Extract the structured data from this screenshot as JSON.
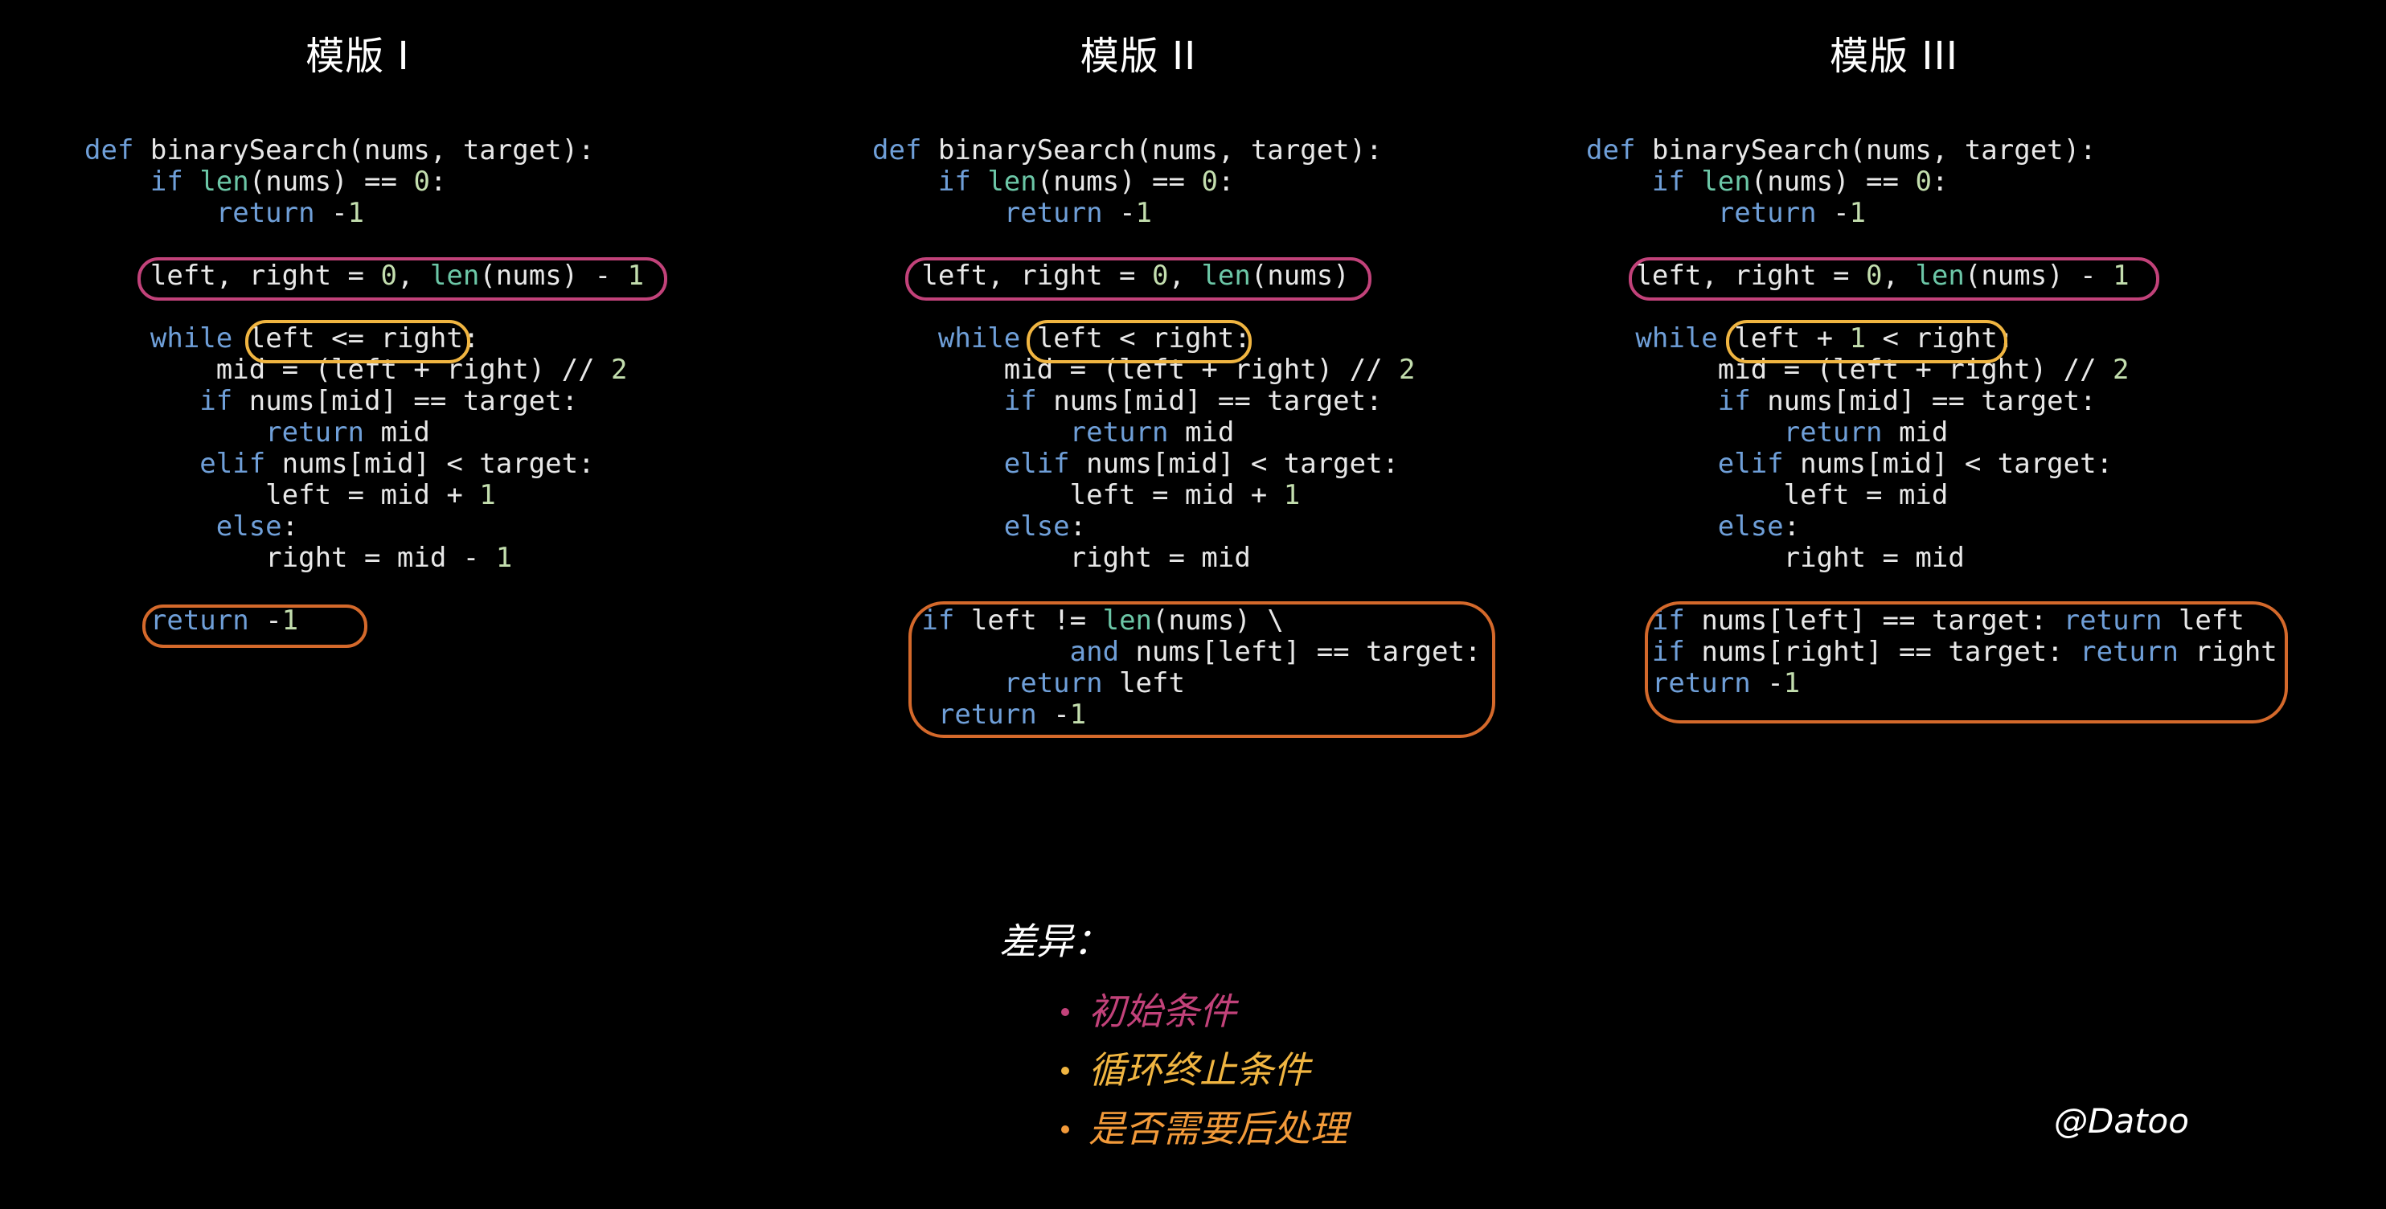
{
  "titles": [
    "模版 I",
    "模版 II",
    "模版 III"
  ],
  "colors": {
    "keyword": "#6f9fd8",
    "builtin": "#6cc7a7",
    "number": "#c3deae",
    "text": "#e8e8e8",
    "init_highlight": "#c2427a",
    "loop_highlight": "#f0b541",
    "post_highlight": "#d4692b"
  },
  "templates": [
    {
      "name": "模版 I",
      "lines": [
        [
          [
            "kw",
            "def"
          ],
          [
            "t",
            " binarySearch(nums, target):"
          ]
        ],
        [
          [
            "t",
            "    "
          ],
          [
            "kw",
            "if"
          ],
          [
            "t",
            " "
          ],
          [
            "fn",
            "len"
          ],
          [
            "t",
            "(nums) == "
          ],
          [
            "num",
            "0"
          ],
          [
            "t",
            ":"
          ]
        ],
        [
          [
            "t",
            "        "
          ],
          [
            "kw",
            "return"
          ],
          [
            "t",
            " -"
          ],
          [
            "num",
            "1"
          ]
        ],
        [],
        [
          [
            "t",
            "    left, right = "
          ],
          [
            "num",
            "0"
          ],
          [
            "t",
            ", "
          ],
          [
            "fn",
            "len"
          ],
          [
            "t",
            "(nums) - "
          ],
          [
            "num",
            "1"
          ]
        ],
        [],
        [
          [
            "t",
            "    "
          ],
          [
            "kw",
            "while"
          ],
          [
            "t",
            " left <= right:"
          ]
        ],
        [
          [
            "t",
            "        mid = (left + right) // "
          ],
          [
            "num",
            "2"
          ]
        ],
        [
          [
            "t",
            "       "
          ],
          [
            "kw",
            "if"
          ],
          [
            "t",
            " nums[mid] == target:"
          ]
        ],
        [
          [
            "t",
            "           "
          ],
          [
            "kw",
            "return"
          ],
          [
            "t",
            " mid"
          ]
        ],
        [
          [
            "t",
            "       "
          ],
          [
            "kw",
            "elif"
          ],
          [
            "t",
            " nums[mid] < target:"
          ]
        ],
        [
          [
            "t",
            "           left = mid + "
          ],
          [
            "num",
            "1"
          ]
        ],
        [
          [
            "t",
            "        "
          ],
          [
            "kw",
            "else"
          ],
          [
            "t",
            ":"
          ]
        ],
        [
          [
            "t",
            "           right = mid - "
          ],
          [
            "num",
            "1"
          ]
        ],
        [],
        [
          [
            "t",
            "    "
          ],
          [
            "kw",
            "return"
          ],
          [
            "t",
            " -"
          ],
          [
            "num",
            "1"
          ]
        ]
      ]
    },
    {
      "name": "模版 II",
      "lines": [
        [
          [
            "kw",
            "def"
          ],
          [
            "t",
            " binarySearch(nums, target):"
          ]
        ],
        [
          [
            "t",
            "    "
          ],
          [
            "kw",
            "if"
          ],
          [
            "t",
            " "
          ],
          [
            "fn",
            "len"
          ],
          [
            "t",
            "(nums) == "
          ],
          [
            "num",
            "0"
          ],
          [
            "t",
            ":"
          ]
        ],
        [
          [
            "t",
            "        "
          ],
          [
            "kw",
            "return"
          ],
          [
            "t",
            " -"
          ],
          [
            "num",
            "1"
          ]
        ],
        [],
        [
          [
            "t",
            "   left, right = "
          ],
          [
            "num",
            "0"
          ],
          [
            "t",
            ", "
          ],
          [
            "fn",
            "len"
          ],
          [
            "t",
            "(nums)"
          ]
        ],
        [],
        [
          [
            "t",
            "    "
          ],
          [
            "kw",
            "while"
          ],
          [
            "t",
            " left < right:"
          ]
        ],
        [
          [
            "t",
            "        mid = (left + right) // "
          ],
          [
            "num",
            "2"
          ]
        ],
        [
          [
            "t",
            "        "
          ],
          [
            "kw",
            "if"
          ],
          [
            "t",
            " nums[mid] == target:"
          ]
        ],
        [
          [
            "t",
            "            "
          ],
          [
            "kw",
            "return"
          ],
          [
            "t",
            " mid"
          ]
        ],
        [
          [
            "t",
            "        "
          ],
          [
            "kw",
            "elif"
          ],
          [
            "t",
            " nums[mid] < target:"
          ]
        ],
        [
          [
            "t",
            "            left = mid + "
          ],
          [
            "num",
            "1"
          ]
        ],
        [
          [
            "t",
            "        "
          ],
          [
            "kw",
            "else"
          ],
          [
            "t",
            ":"
          ]
        ],
        [
          [
            "t",
            "            right = mid"
          ]
        ],
        [],
        [
          [
            "t",
            "   "
          ],
          [
            "kw",
            "if"
          ],
          [
            "t",
            " left != "
          ],
          [
            "fn",
            "len"
          ],
          [
            "t",
            "(nums) \\"
          ]
        ],
        [
          [
            "t",
            "            "
          ],
          [
            "kw",
            "and"
          ],
          [
            "t",
            " nums[left] == target:"
          ]
        ],
        [
          [
            "t",
            "        "
          ],
          [
            "kw",
            "return"
          ],
          [
            "t",
            " left"
          ]
        ],
        [
          [
            "t",
            "    "
          ],
          [
            "kw",
            "return"
          ],
          [
            "t",
            " -"
          ],
          [
            "num",
            "1"
          ]
        ]
      ]
    },
    {
      "name": "模版 III",
      "lines": [
        [
          [
            "kw",
            "def"
          ],
          [
            "t",
            " binarySearch(nums, target):"
          ]
        ],
        [
          [
            "t",
            "    "
          ],
          [
            "kw",
            "if"
          ],
          [
            "t",
            " "
          ],
          [
            "fn",
            "len"
          ],
          [
            "t",
            "(nums) == "
          ],
          [
            "num",
            "0"
          ],
          [
            "t",
            ":"
          ]
        ],
        [
          [
            "t",
            "        "
          ],
          [
            "kw",
            "return"
          ],
          [
            "t",
            " -"
          ],
          [
            "num",
            "1"
          ]
        ],
        [],
        [
          [
            "t",
            "   left, right = "
          ],
          [
            "num",
            "0"
          ],
          [
            "t",
            ", "
          ],
          [
            "fn",
            "len"
          ],
          [
            "t",
            "(nums) - "
          ],
          [
            "num",
            "1"
          ]
        ],
        [],
        [
          [
            "t",
            "   "
          ],
          [
            "kw",
            "while"
          ],
          [
            "t",
            " left + "
          ],
          [
            "num",
            "1"
          ],
          [
            "t",
            " < right:"
          ]
        ],
        [
          [
            "t",
            "        mid = (left + right) // "
          ],
          [
            "num",
            "2"
          ]
        ],
        [
          [
            "t",
            "        "
          ],
          [
            "kw",
            "if"
          ],
          [
            "t",
            " nums[mid] == target:"
          ]
        ],
        [
          [
            "t",
            "            "
          ],
          [
            "kw",
            "return"
          ],
          [
            "t",
            " mid"
          ]
        ],
        [
          [
            "t",
            "        "
          ],
          [
            "kw",
            "elif"
          ],
          [
            "t",
            " nums[mid] < target:"
          ]
        ],
        [
          [
            "t",
            "            left = mid"
          ]
        ],
        [
          [
            "t",
            "        "
          ],
          [
            "kw",
            "else"
          ],
          [
            "t",
            ":"
          ]
        ],
        [
          [
            "t",
            "            right = mid"
          ]
        ],
        [],
        [
          [
            "t",
            "    "
          ],
          [
            "kw",
            "if"
          ],
          [
            "t",
            " nums[left] == target: "
          ],
          [
            "kw",
            "return"
          ],
          [
            "t",
            " left"
          ]
        ],
        [
          [
            "t",
            "    "
          ],
          [
            "kw",
            "if"
          ],
          [
            "t",
            " nums[right] == target: "
          ],
          [
            "kw",
            "return"
          ],
          [
            "t",
            " right"
          ]
        ],
        [
          [
            "t",
            "    "
          ],
          [
            "kw",
            "return"
          ],
          [
            "t",
            " -"
          ],
          [
            "num",
            "1"
          ]
        ]
      ]
    }
  ],
  "differences": {
    "title": "差异：",
    "items": [
      {
        "label": "初始条件",
        "color": "#c2427a"
      },
      {
        "label": "循环终止条件",
        "color": "#f0b541"
      },
      {
        "label": "是否需要后处理",
        "color": "#f29a3a"
      }
    ]
  },
  "signature": "@Datoo"
}
